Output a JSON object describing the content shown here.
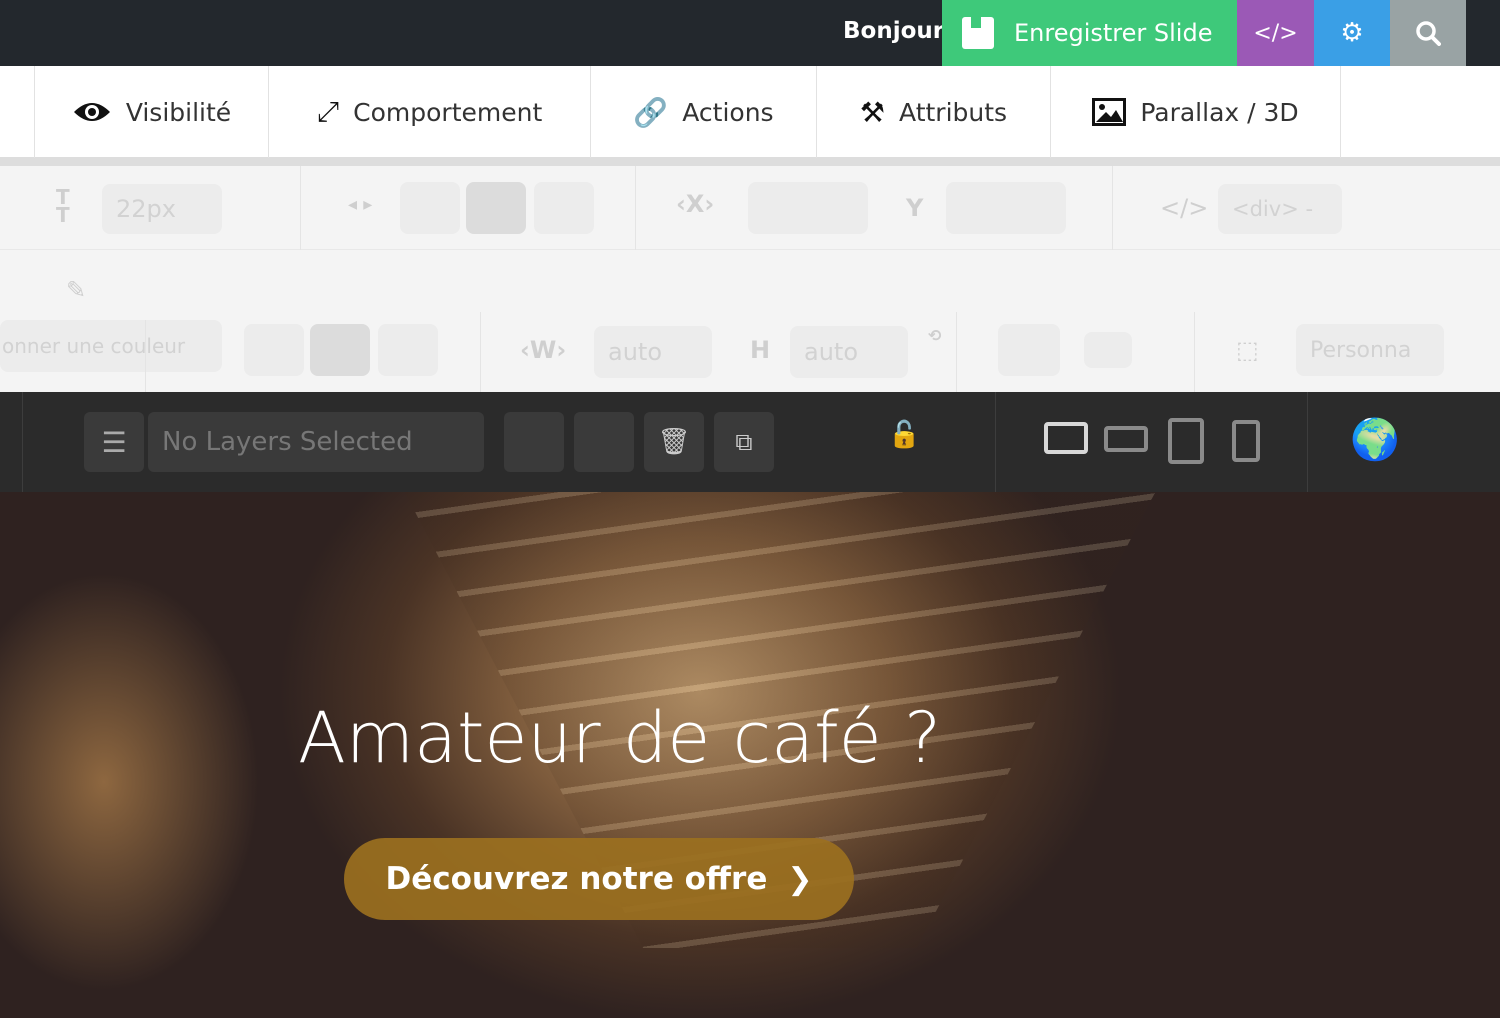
{
  "topbar": {
    "greeting": "Bonjour,",
    "save_label": "Enregistrer Slide",
    "code_label": "</>"
  },
  "tabs": [
    {
      "label": "Visibilité",
      "icon": "eye-icon"
    },
    {
      "label": "Comportement",
      "icon": "expand-icon"
    },
    {
      "label": "Actions",
      "icon": "link-icon"
    },
    {
      "label": "Attributs",
      "icon": "tools-icon"
    },
    {
      "label": "Parallax / 3D",
      "icon": "image-icon"
    }
  ],
  "toolbar": {
    "font_size": "22px",
    "x_label": "X",
    "y_label": "Y",
    "tag_select": "<div> -",
    "color_select": "onner une couleur",
    "w_label": "W",
    "width_value": "auto",
    "h_label": "H",
    "height_value": "auto",
    "size_preset": "Personna"
  },
  "layerbar": {
    "layer_placeholder": "No Layers Selected"
  },
  "slide": {
    "headline": "Amateur de café ?",
    "cta_label": "Découvrez notre offre",
    "cta_color": "#9b7020"
  }
}
